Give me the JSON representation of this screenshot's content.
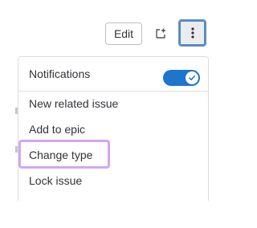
{
  "toolbar": {
    "edit_label": "Edit",
    "new_window_icon": "new-window-icon",
    "more_actions_icon": "kebab-vertical-icon"
  },
  "menu": {
    "notifications": {
      "label": "Notifications",
      "enabled": true
    },
    "items": [
      {
        "label": "New related issue"
      },
      {
        "label": "Add to epic"
      },
      {
        "label": "Change type",
        "highlighted": true
      },
      {
        "label": "Lock issue"
      }
    ]
  },
  "colors": {
    "toggle_on": "#1f75cb",
    "highlight_outline": "#d4a6f0",
    "focus_ring": "#428fdc"
  }
}
